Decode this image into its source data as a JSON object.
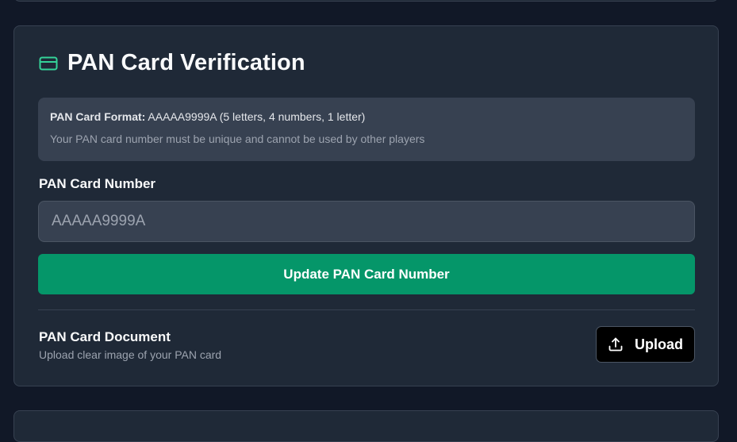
{
  "section": {
    "title": "PAN Card Verification",
    "icon": "credit-card-icon",
    "accent_color": "#34d399"
  },
  "info": {
    "format_label": "PAN Card Format:",
    "format_value": " AAAAA9999A (5 letters, 4 numbers, 1 letter)",
    "note": "Your PAN card number must be unique and cannot be used by other players"
  },
  "pan_field": {
    "label": "PAN Card Number",
    "placeholder": "AAAAA9999A",
    "value": ""
  },
  "update_button": {
    "label": "Update PAN Card Number",
    "color": "#059669"
  },
  "document": {
    "title": "PAN Card Document",
    "subtitle": "Upload clear image of your PAN card",
    "upload_label": "Upload",
    "upload_icon": "upload-icon"
  }
}
